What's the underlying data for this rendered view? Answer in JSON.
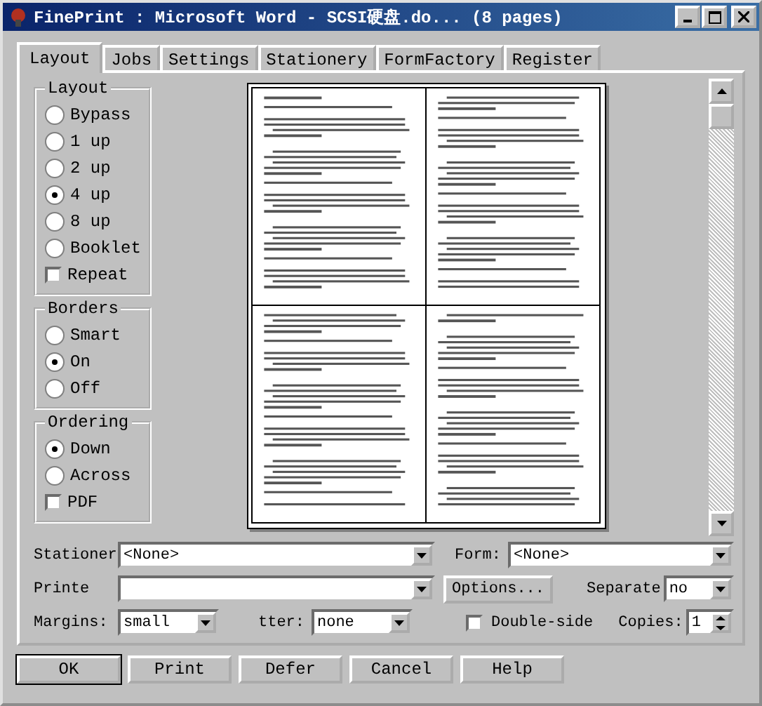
{
  "window": {
    "title": "FinePrint : Microsoft Word - SCSI硬盘.do... (8 pages)"
  },
  "tabs": [
    {
      "label": "Layout",
      "selected": true
    },
    {
      "label": "Jobs",
      "selected": false
    },
    {
      "label": "Settings",
      "selected": false
    },
    {
      "label": "Stationery",
      "selected": false
    },
    {
      "label": "FormFactory",
      "selected": false
    },
    {
      "label": "Register",
      "selected": false
    }
  ],
  "groups": [
    {
      "title": "Layout",
      "options": [
        {
          "kind": "radio",
          "label": "Bypass",
          "selected": false
        },
        {
          "kind": "radio",
          "label": "1 up",
          "selected": false
        },
        {
          "kind": "radio",
          "label": "2 up",
          "selected": false
        },
        {
          "kind": "radio",
          "label": "4 up",
          "selected": true
        },
        {
          "kind": "radio",
          "label": "8 up",
          "selected": false
        },
        {
          "kind": "radio",
          "label": "Booklet",
          "selected": false
        },
        {
          "kind": "checkbox",
          "label": "Repeat",
          "checked": false
        }
      ]
    },
    {
      "title": "Borders",
      "options": [
        {
          "kind": "radio",
          "label": "Smart",
          "selected": false
        },
        {
          "kind": "radio",
          "label": "On",
          "selected": true
        },
        {
          "kind": "radio",
          "label": "Off",
          "selected": false
        }
      ]
    },
    {
      "title": "Ordering",
      "options": [
        {
          "kind": "radio",
          "label": "Down",
          "selected": true
        },
        {
          "kind": "radio",
          "label": "Across",
          "selected": false
        },
        {
          "kind": "checkbox",
          "label": "PDF",
          "checked": false
        }
      ]
    }
  ],
  "fields": {
    "stationery": {
      "label": "Stationer",
      "value": "<None>"
    },
    "form": {
      "label": "Form:",
      "value": "<None>"
    },
    "printer": {
      "label": "Printe"
    },
    "options_button": "Options...",
    "separate": {
      "label": "Separate",
      "value": "no"
    },
    "margins": {
      "label": "Margins:",
      "value": "small"
    },
    "gutter": {
      "label": "tter:",
      "value": "none"
    },
    "double_sided": {
      "label": "Double-side",
      "checked": false
    },
    "copies": {
      "label": "Copies:",
      "value": "1"
    }
  },
  "buttons": [
    {
      "label": "OK",
      "default": true
    },
    {
      "label": "Print",
      "default": false
    },
    {
      "label": "Defer",
      "default": false
    },
    {
      "label": "Cancel",
      "default": false
    },
    {
      "label": "Help",
      "default": false
    }
  ]
}
